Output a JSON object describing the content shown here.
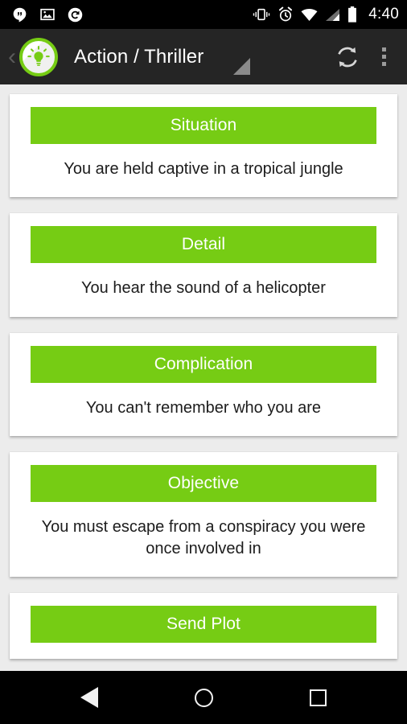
{
  "status_bar": {
    "icons_left": [
      "hangouts-icon",
      "photo-icon",
      "sync-circle-icon"
    ],
    "icons_right": [
      "vibrate-icon",
      "alarm-icon",
      "wifi-icon",
      "signal-icon",
      "battery-icon"
    ],
    "time": "4:40"
  },
  "app_bar": {
    "back_label": "‹",
    "app_icon": "lightbulb-icon",
    "title": "Action / Thriller",
    "spinner_indicator": "dropdown-triangle-icon",
    "actions": [
      {
        "name": "refresh-button",
        "icon": "refresh-icon"
      },
      {
        "name": "overflow-menu-button",
        "icon": "more-vert-icon"
      }
    ]
  },
  "theme": {
    "accent_green": "#76cc14",
    "app_bar_bg": "#252525",
    "page_bg": "#ececec",
    "card_bg": "#ffffff",
    "body_text": "#1c1c1c"
  },
  "cards": [
    {
      "header": "Situation",
      "body": "You are held captive in a tropical jungle"
    },
    {
      "header": "Detail",
      "body": "You hear the sound of a helicopter"
    },
    {
      "header": "Complication",
      "body": "You can't remember who you are"
    },
    {
      "header": "Objective",
      "body": "You must escape from a conspiracy you were once involved in"
    }
  ],
  "send_button": {
    "label": "Send Plot"
  },
  "nav_bar": {
    "back": "nav-back-icon",
    "home": "nav-home-icon",
    "recents": "nav-recents-icon"
  }
}
